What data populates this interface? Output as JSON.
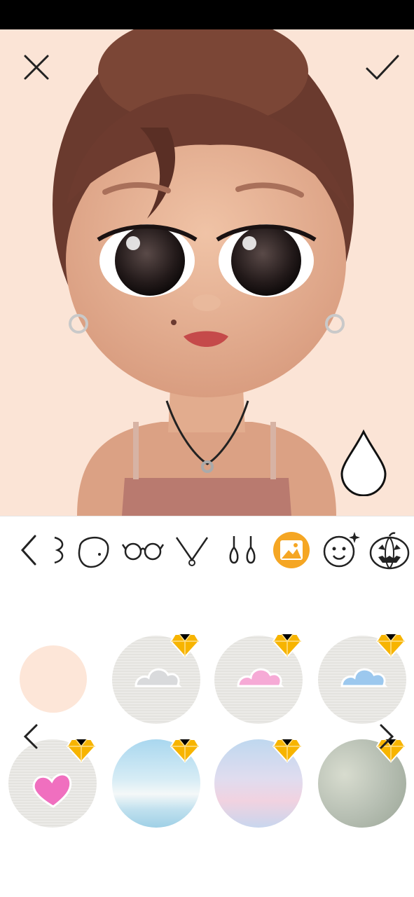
{
  "screen": {
    "name": "avatar-background-editor"
  },
  "colors": {
    "canvas_background": "#fbe4d6",
    "selected_tool_accent": "#f5a623",
    "premium_gem": "#f7b400"
  },
  "header": {
    "close_icon": "close-icon",
    "confirm_icon": "checkmark-icon",
    "color_picker_icon": "water-drop-icon"
  },
  "toolbar": {
    "items": [
      {
        "icon": "chevron-left-icon",
        "selected": false
      },
      {
        "icon": "ear-icon",
        "selected": false
      },
      {
        "icon": "face-shape-icon",
        "selected": false
      },
      {
        "icon": "glasses-icon",
        "selected": false
      },
      {
        "icon": "necklace-icon",
        "selected": false
      },
      {
        "icon": "earrings-icon",
        "selected": false
      },
      {
        "icon": "background-icon",
        "selected": true
      },
      {
        "icon": "sparkle-face-icon",
        "selected": false
      },
      {
        "icon": "pumpkin-icon",
        "selected": false
      }
    ]
  },
  "backgrounds": {
    "items": [
      {
        "name": "solid-peach",
        "color": "#fde6d8",
        "premium": false
      },
      {
        "name": "grey-cloud",
        "color": "#d9dadc",
        "premium": true
      },
      {
        "name": "pink-cloud",
        "color": "#f6aad6",
        "premium": true
      },
      {
        "name": "blue-cloud",
        "color": "#9cc8ee",
        "premium": true
      },
      {
        "name": "pink-heart",
        "color": "#f06fbf",
        "premium": true
      },
      {
        "name": "sky-clouds",
        "color": "#a9d7ef",
        "premium": true
      },
      {
        "name": "pastel-sea",
        "color": "#d7cfe8",
        "premium": true
      },
      {
        "name": "bokeh-green",
        "color": "#b8c0b4",
        "premium": true
      }
    ],
    "prev_icon": "chevron-left-icon",
    "next_icon": "chevron-right-icon"
  }
}
